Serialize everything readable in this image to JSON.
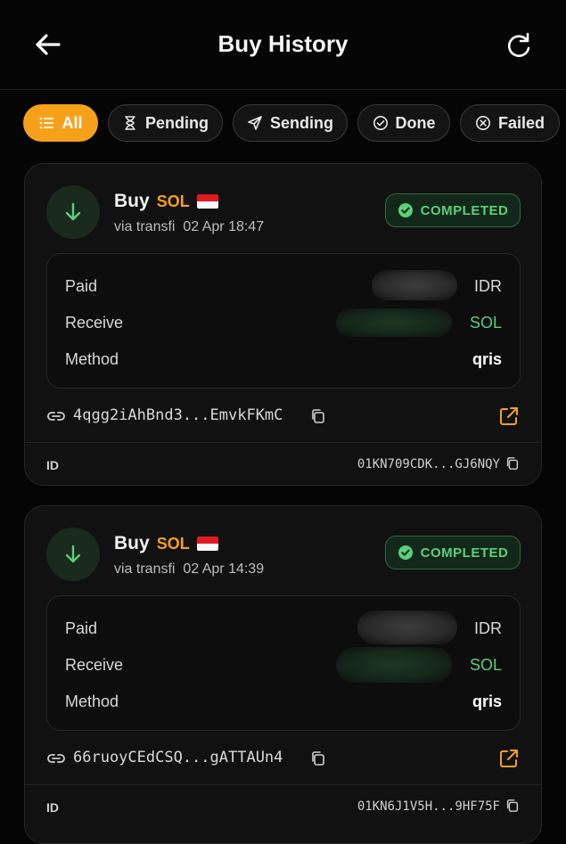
{
  "header": {
    "title": "Buy History",
    "back_icon": "arrow-left-icon",
    "refresh_icon": "refresh-icon"
  },
  "filters": [
    {
      "label": "All",
      "icon": "list-icon",
      "active": true
    },
    {
      "label": "Pending",
      "icon": "hourglass-icon",
      "active": false
    },
    {
      "label": "Sending",
      "icon": "send-icon",
      "active": false
    },
    {
      "label": "Done",
      "icon": "check-circle-icon",
      "active": false
    },
    {
      "label": "Failed",
      "icon": "x-circle-icon",
      "active": false
    }
  ],
  "labels": {
    "paid": "Paid",
    "receive": "Receive",
    "method": "Method",
    "id": "ID"
  },
  "orders": [
    {
      "action": "Buy",
      "token": "SOL",
      "flag": "Indonesia",
      "provider": "via transfi",
      "date": "02 Apr 18:47",
      "status": "COMPLETED",
      "paid_currency": "IDR",
      "receive_currency": "SOL",
      "method": "qris",
      "tx_hash": "4qgg2iAhBnd3...EmvkFKmC",
      "order_id": "01KN709CDK...GJ6NQY"
    },
    {
      "action": "Buy",
      "token": "SOL",
      "flag": "Indonesia",
      "provider": "via transfi",
      "date": "02 Apr 14:39",
      "status": "COMPLETED",
      "paid_currency": "IDR",
      "receive_currency": "SOL",
      "method": "qris",
      "tx_hash": "66ruoyCEdCSQ...gATTAUn4",
      "order_id": "01KN6J1V5H...9HF75F"
    }
  ],
  "colors": {
    "accent": "#f7a11a",
    "success": "#5bd07a",
    "background": "#050505",
    "card": "#111111"
  }
}
